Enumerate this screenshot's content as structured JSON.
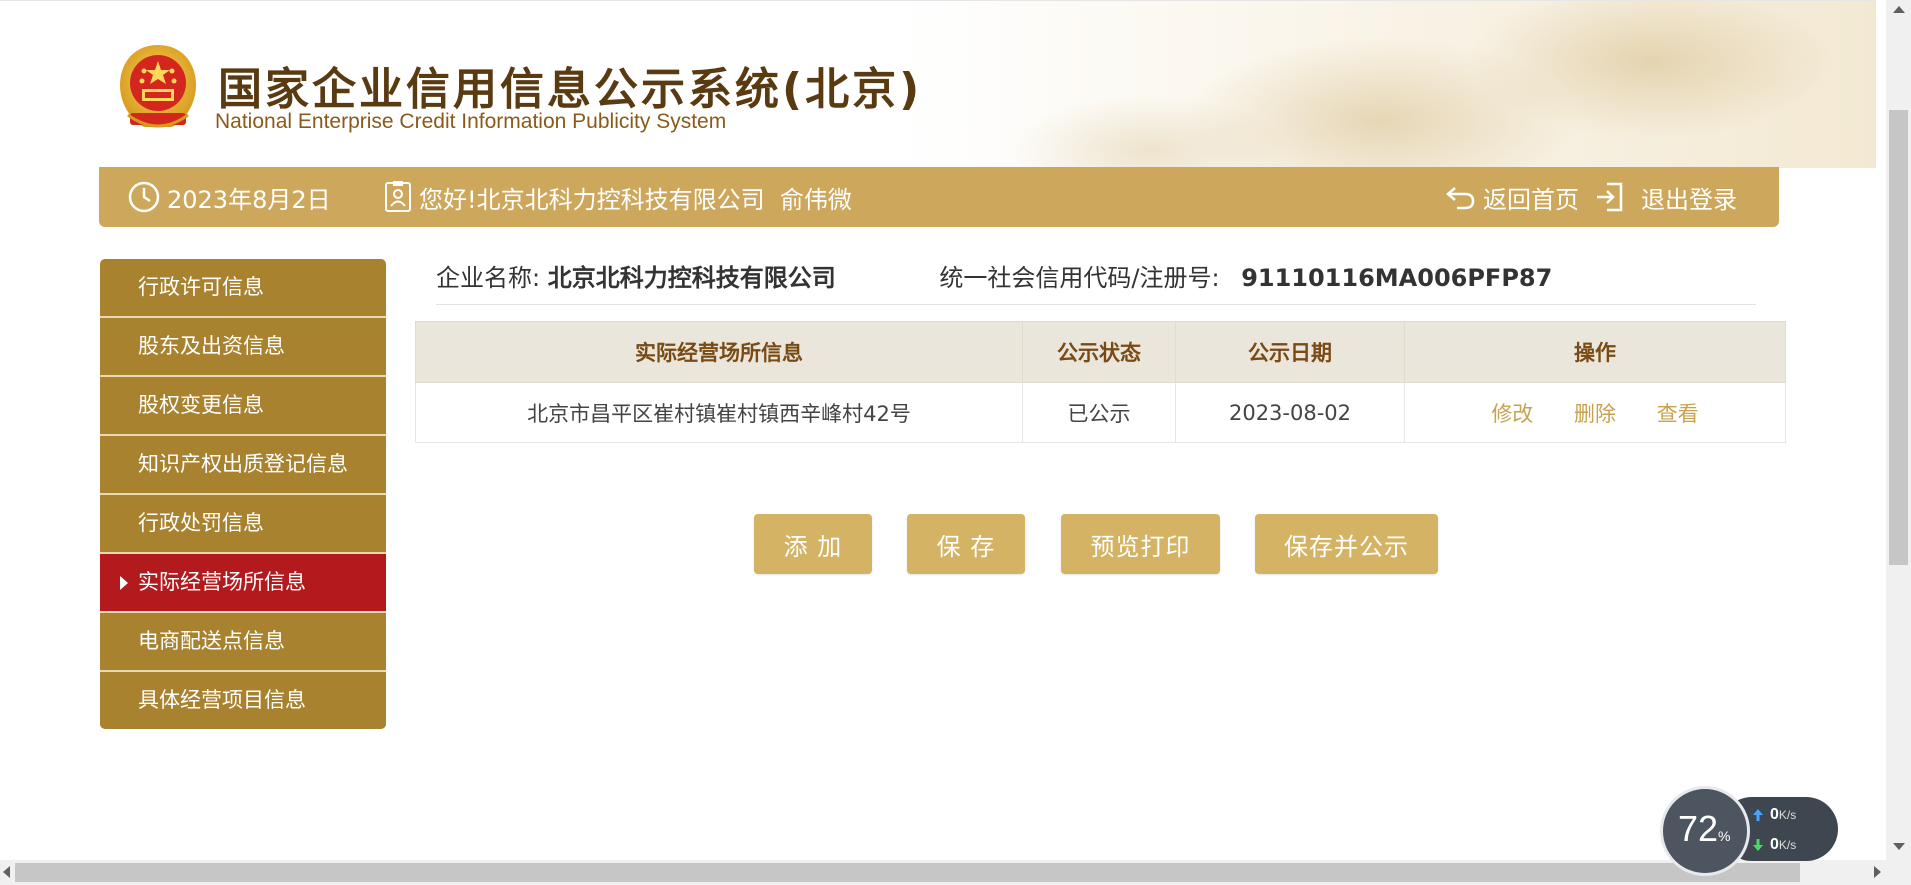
{
  "header": {
    "title_cn": "国家企业信用信息公示系统(北京)",
    "title_en": "National Enterprise Credit Information Publicity System"
  },
  "topbar": {
    "date": "2023年8月2日",
    "greeting": "您好!北京北科力控科技有限公司  俞伟微",
    "home_label": "返回首页",
    "logout_label": "退出登录"
  },
  "sidebar": {
    "items": [
      {
        "label": "行政许可信息",
        "active": false
      },
      {
        "label": "股东及出资信息",
        "active": false
      },
      {
        "label": "股权变更信息",
        "active": false
      },
      {
        "label": "知识产权出质登记信息",
        "active": false
      },
      {
        "label": "行政处罚信息",
        "active": false
      },
      {
        "label": "实际经营场所信息",
        "active": true
      },
      {
        "label": "电商配送点信息",
        "active": false
      },
      {
        "label": "具体经营项目信息",
        "active": false
      }
    ]
  },
  "company": {
    "name_label": "企业名称:",
    "name_value": "北京北科力控科技有限公司",
    "code_label": "统一社会信用代码/注册号:",
    "code_value": "91110116MA006PFP87"
  },
  "table": {
    "headers": [
      "实际经营场所信息",
      "公示状态",
      "公示日期",
      "操作"
    ],
    "rows": [
      {
        "address": "北京市昌平区崔村镇崔村镇西辛峰村42号",
        "status": "已公示",
        "date": "2023-08-02",
        "actions": [
          "修改",
          "删除",
          "查看"
        ]
      }
    ]
  },
  "buttons": {
    "add": "添 加",
    "save": "保 存",
    "preview_print": "预览打印",
    "save_publish": "保存并公示"
  },
  "widget": {
    "percent": "72",
    "percent_unit": "%",
    "upload": "0",
    "download": "0",
    "unit": "K/s"
  },
  "colors": {
    "gold_bar": "#cda85c",
    "sidebar": "#a8822e",
    "sidebar_active": "#b21a1e",
    "button": "#d4b464",
    "link": "#c8a24e"
  }
}
